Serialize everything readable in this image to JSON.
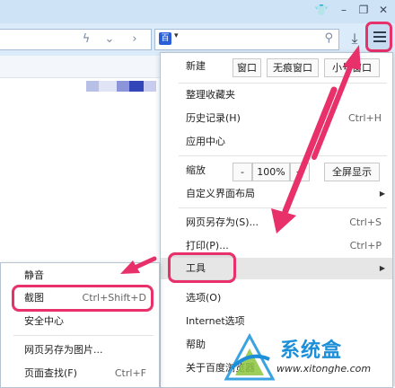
{
  "window": {
    "titlebar_icons": [
      "shirt-icon",
      "minimize-icon",
      "restore-icon",
      "close-icon"
    ],
    "accent_color": "#e8306a"
  },
  "toolbar": {
    "engine_label": "百",
    "dropdown_caret": "▾",
    "menu_button_icon": "hamburger-icon"
  },
  "menu": {
    "new_label": "新建",
    "new_buttons": [
      "窗口",
      "无痕窗口",
      "小号窗口"
    ],
    "items": [
      {
        "label": "整理收藏夹",
        "shortcut": ""
      },
      {
        "label": "历史记录(H)",
        "shortcut": "Ctrl+H"
      },
      {
        "label": "应用中心",
        "shortcut": ""
      }
    ],
    "zoom": {
      "label": "缩放",
      "minus": "-",
      "value": "100%",
      "plus": "+",
      "fullscreen": "全屏显示"
    },
    "customize_label": "自定义界面布局",
    "save_as": {
      "label": "网页另存为(S)...",
      "shortcut": "Ctrl+S"
    },
    "print": {
      "label": "打印(P)...",
      "shortcut": "Ctrl+P"
    },
    "tools_label": "工具",
    "options_label": "选项(O)",
    "internet_options_label": "Internet选项",
    "help_label": "帮助",
    "about_label": "关于百度浏览器"
  },
  "submenu": {
    "items": [
      {
        "label": "静音",
        "shortcut": ""
      },
      {
        "label": "截图",
        "shortcut": "Ctrl+Shift+D"
      },
      {
        "label": "安全中心",
        "shortcut": ""
      },
      {
        "label": "网页另存为图片...",
        "shortcut": ""
      },
      {
        "label": "页面查找(F)",
        "shortcut": "Ctrl+F"
      }
    ]
  },
  "watermark": {
    "text": "系统盒",
    "url": "www.xitonghe.com"
  }
}
